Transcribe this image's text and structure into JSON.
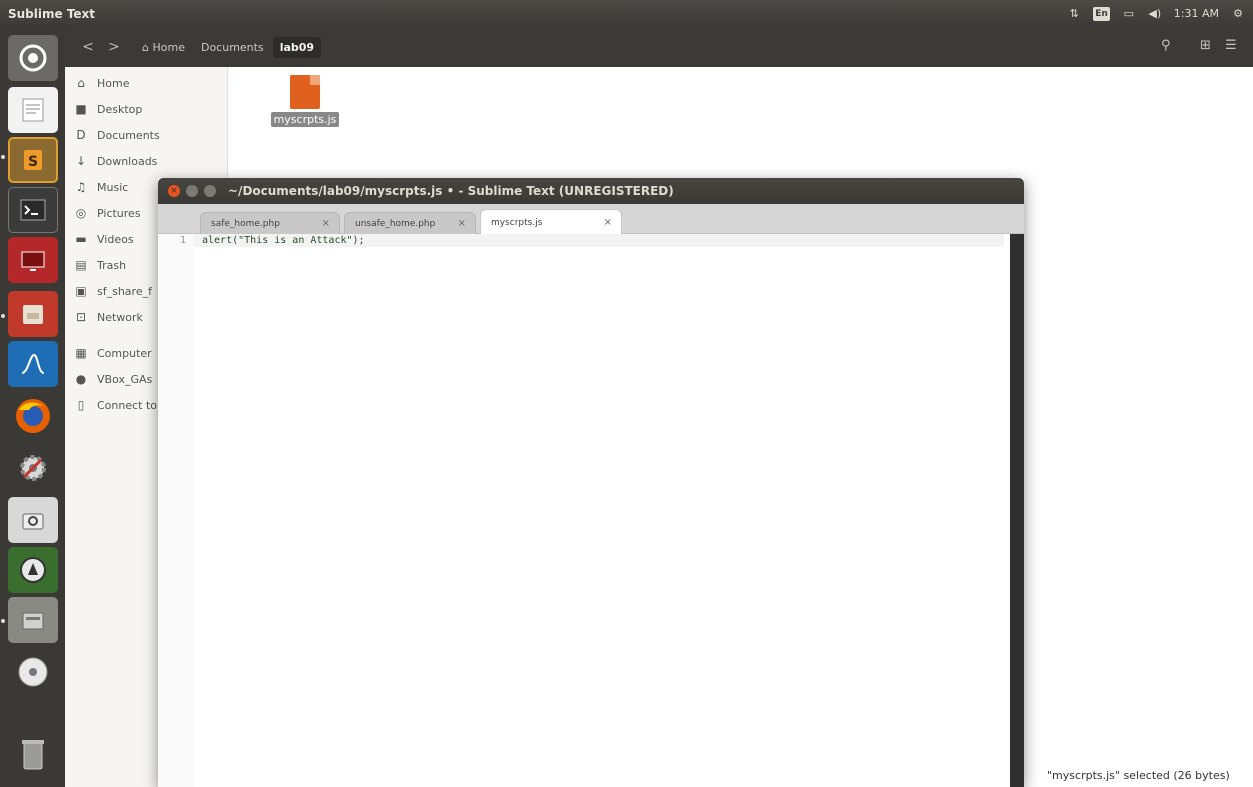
{
  "topbar": {
    "app_name": "Sublime Text",
    "indicators": {
      "network": "⇅",
      "keyboard": "En",
      "battery": "▭",
      "volume": "◀)",
      "time": "1:31 AM",
      "power": "⚙"
    }
  },
  "launcher": {
    "items": [
      "dash",
      "text-editor",
      "sublime-text",
      "terminal",
      "remote",
      "files",
      "wireshark",
      "firefox",
      "settings",
      "camera",
      "utility",
      "archive",
      "disc",
      "trash"
    ]
  },
  "nautilus": {
    "breadcrumb": {
      "back": "<",
      "forward": ">",
      "home": "Home",
      "items": [
        "Documents",
        "lab09"
      ]
    },
    "sidebar": {
      "items": [
        {
          "label": "Home",
          "icon": "⌂"
        },
        {
          "label": "Desktop",
          "icon": "■"
        },
        {
          "label": "Documents",
          "icon": "D"
        },
        {
          "label": "Downloads",
          "icon": "↓"
        },
        {
          "label": "Music",
          "icon": "♫"
        },
        {
          "label": "Pictures",
          "icon": "◎"
        },
        {
          "label": "Videos",
          "icon": "▬"
        },
        {
          "label": "Trash",
          "icon": "▤"
        },
        {
          "label": "sf_share_f",
          "icon": "▣"
        },
        {
          "label": "Network",
          "icon": "⊡"
        },
        {
          "label": "Computer",
          "icon": "▦"
        },
        {
          "label": "VBox_GAs",
          "icon": "●"
        },
        {
          "label": "Connect to",
          "icon": "▯"
        }
      ]
    },
    "file": {
      "name": "myscrpts.js"
    },
    "status": "\"myscrpts.js\" selected  (26 bytes)"
  },
  "sublime": {
    "title": "~/Documents/lab09/myscrpts.js • - Sublime Text (UNREGISTERED)",
    "tabs": [
      {
        "label": "safe_home.php",
        "close": "×"
      },
      {
        "label": "unsafe_home.php",
        "close": "×"
      },
      {
        "label": "myscrpts.js",
        "close": "×"
      }
    ],
    "editor": {
      "line_numbers": [
        "1"
      ],
      "code": "alert(\"This is an Attack\");"
    }
  },
  "colors": {
    "accent": "#e95420",
    "topbar": "#3c3b37",
    "sidebar": "#f6f5f4"
  }
}
